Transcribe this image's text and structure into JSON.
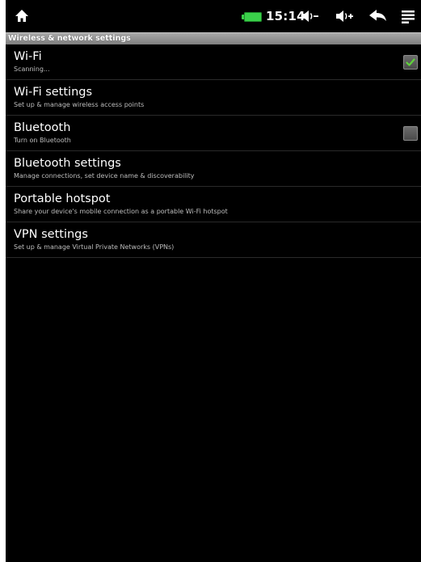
{
  "status_bar": {
    "time": "15:14",
    "battery_color": "#3ad04a",
    "icons": [
      "home-icon",
      "battery-icon",
      "volume-down-icon",
      "volume-up-icon",
      "back-icon",
      "menu-icon"
    ]
  },
  "header": {
    "title": "Wireless & network settings"
  },
  "settings": [
    {
      "title": "Wi-Fi",
      "summary": "Scanning...",
      "checkbox": true,
      "checked": true
    },
    {
      "title": "Wi-Fi settings",
      "summary": "Set up & manage wireless access points",
      "checkbox": false
    },
    {
      "title": "Bluetooth",
      "summary": "Turn on Bluetooth",
      "checkbox": true,
      "checked": false
    },
    {
      "title": "Bluetooth settings",
      "summary": "Manage connections, set device name & discoverability",
      "checkbox": false
    },
    {
      "title": "Portable hotspot",
      "summary": "Share your device's mobile connection as a portable Wi-Fi hotspot",
      "checkbox": false
    },
    {
      "title": "VPN settings",
      "summary": "Set up & manage Virtual Private Networks (VPNs)",
      "checkbox": false
    }
  ],
  "colors": {
    "background": "#000000",
    "check_mark": "#5fd23a",
    "header_bar": "#969696"
  }
}
